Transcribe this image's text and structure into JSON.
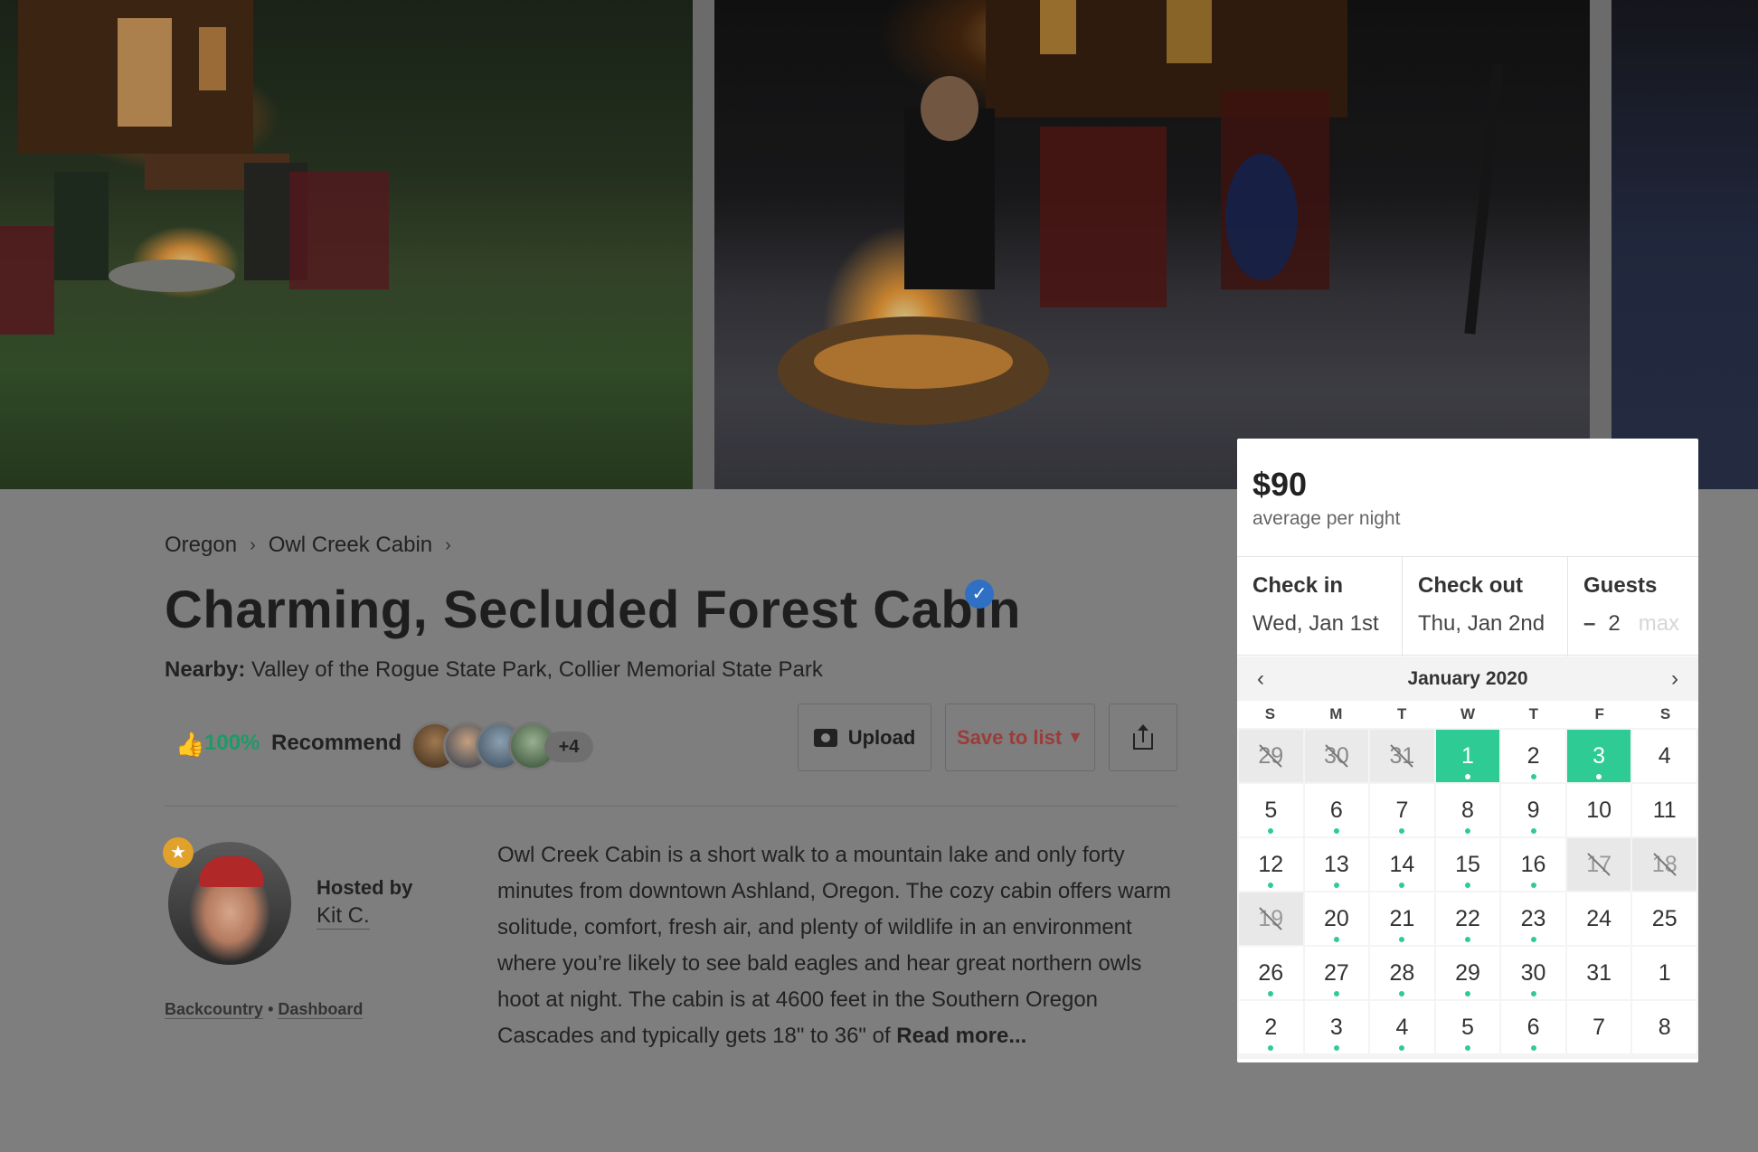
{
  "breadcrumb": {
    "items": [
      "Oregon",
      "Owl Creek Cabin"
    ],
    "separator": "›"
  },
  "listing": {
    "title": "Charming, Secluded Forest Cabin",
    "verified_icon": "check-badge-icon",
    "nearby_label": "Nearby:",
    "nearby_value": "Valley of the Rogue State Park, Collier Memorial State Park"
  },
  "recommend": {
    "percent": "100%",
    "label": "Recommend",
    "more_count": "+4"
  },
  "actions": {
    "upload_label": "Upload",
    "save_label": "Save to list",
    "save_chevron": "⌄"
  },
  "host": {
    "hosted_by": "Hosted by",
    "name": "Kit C.",
    "links": [
      "Backcountry",
      "Dashboard"
    ],
    "link_sep": "•"
  },
  "description": {
    "text": "Owl Creek Cabin is a short walk to a mountain lake and only forty minutes from downtown Ashland, Oregon. The cozy cabin offers warm solitude, comfort, fresh air, and plenty of wildlife in an environment where you’re likely to see bald eagles and hear great northern owls hoot at night. The cabin is at 4600 feet in the Southern Oregon Cascades and typically gets 18\" to 36\" of",
    "read_more": "Read more..."
  },
  "booking": {
    "price": "$90",
    "price_sub": "average per night",
    "check_in_label": "Check in",
    "check_in_value": "Wed, Jan 1st",
    "check_out_label": "Check out",
    "check_out_value": "Thu, Jan 2nd",
    "guests_label": "Guests",
    "guests_minus": "–",
    "guests_value": "2",
    "guests_max": "max",
    "accent_color": "#2fcb95"
  },
  "calendar": {
    "month": "January 2020",
    "prev_icon": "‹",
    "next_icon": "›",
    "weekdays": [
      "S",
      "M",
      "T",
      "W",
      "T",
      "F",
      "S"
    ],
    "weeks": [
      [
        {
          "d": "29",
          "s": "past"
        },
        {
          "d": "30",
          "s": "past"
        },
        {
          "d": "31",
          "s": "past"
        },
        {
          "d": "1",
          "s": "selected"
        },
        {
          "d": "2",
          "s": "available"
        },
        {
          "d": "3",
          "s": "selected"
        },
        {
          "d": "4",
          "s": "normal"
        }
      ],
      [
        {
          "d": "5",
          "s": "available"
        },
        {
          "d": "6",
          "s": "available"
        },
        {
          "d": "7",
          "s": "available"
        },
        {
          "d": "8",
          "s": "available"
        },
        {
          "d": "9",
          "s": "available"
        },
        {
          "d": "10",
          "s": "normal"
        },
        {
          "d": "11",
          "s": "normal"
        }
      ],
      [
        {
          "d": "12",
          "s": "available"
        },
        {
          "d": "13",
          "s": "available"
        },
        {
          "d": "14",
          "s": "available"
        },
        {
          "d": "15",
          "s": "available"
        },
        {
          "d": "16",
          "s": "available"
        },
        {
          "d": "17",
          "s": "blocked"
        },
        {
          "d": "18",
          "s": "blocked"
        }
      ],
      [
        {
          "d": "19",
          "s": "blocked"
        },
        {
          "d": "20",
          "s": "available"
        },
        {
          "d": "21",
          "s": "available"
        },
        {
          "d": "22",
          "s": "available"
        },
        {
          "d": "23",
          "s": "available"
        },
        {
          "d": "24",
          "s": "normal"
        },
        {
          "d": "25",
          "s": "normal"
        }
      ],
      [
        {
          "d": "26",
          "s": "available"
        },
        {
          "d": "27",
          "s": "available"
        },
        {
          "d": "28",
          "s": "available"
        },
        {
          "d": "29",
          "s": "available"
        },
        {
          "d": "30",
          "s": "available"
        },
        {
          "d": "31",
          "s": "normal"
        },
        {
          "d": "1",
          "s": "normal"
        }
      ],
      [
        {
          "d": "2",
          "s": "available"
        },
        {
          "d": "3",
          "s": "available"
        },
        {
          "d": "4",
          "s": "available"
        },
        {
          "d": "5",
          "s": "available"
        },
        {
          "d": "6",
          "s": "available"
        },
        {
          "d": "7",
          "s": "normal"
        },
        {
          "d": "8",
          "s": "normal"
        }
      ]
    ]
  }
}
